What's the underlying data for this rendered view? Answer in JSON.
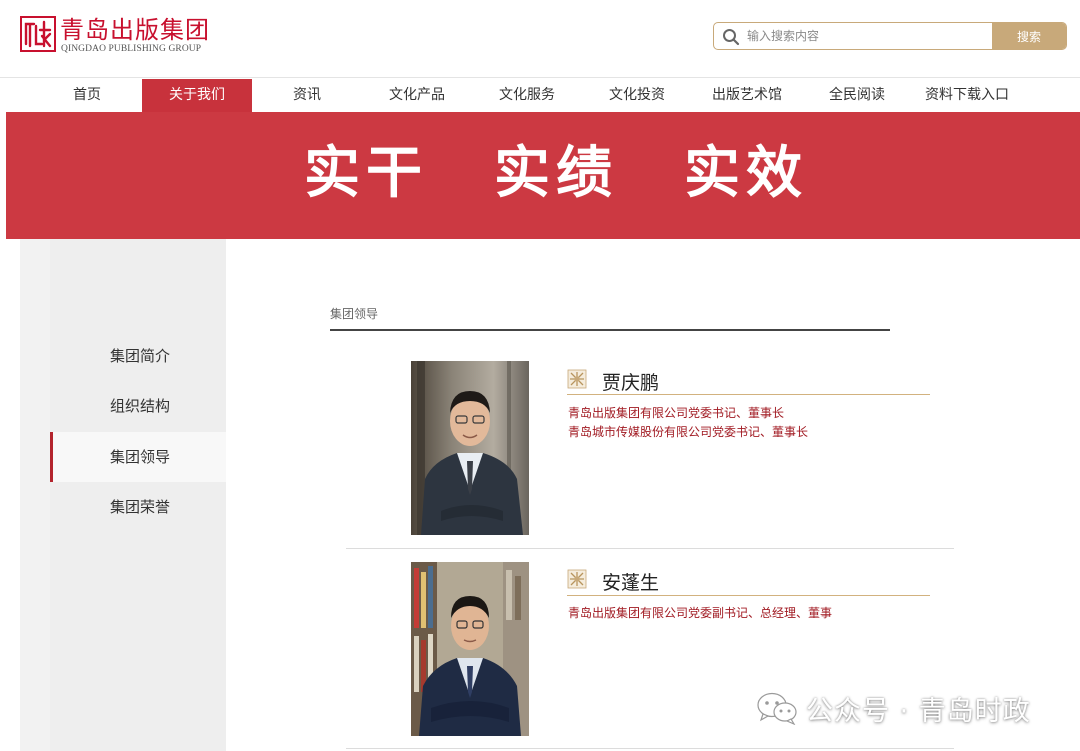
{
  "header": {
    "logo_cn": "青岛出版集团",
    "logo_en": "QINGDAO PUBLISHING GROUP",
    "search_placeholder": "输入搜索内容",
    "search_button": "搜索"
  },
  "nav": {
    "items": [
      "首页",
      "关于我们",
      "资讯",
      "文化产品",
      "文化服务",
      "文化投资",
      "出版艺术馆",
      "全民阅读",
      "资料下载入口"
    ],
    "active_index": 1
  },
  "banner": {
    "words": [
      "实干",
      "实绩",
      "实效"
    ],
    "background": "#cc3942"
  },
  "sidebar": {
    "items": [
      "集团简介",
      "组织结构",
      "集团领导",
      "集团荣誉"
    ],
    "active_index": 2
  },
  "main": {
    "section_title": "集团领导",
    "leaders": [
      {
        "name": "贾庆鹏",
        "titles": [
          "青岛出版集团有限公司党委书记、董事长",
          "青岛城市传媒股份有限公司党委书记、董事长"
        ]
      },
      {
        "name": "安蓬生",
        "titles": [
          "青岛出版集团有限公司党委副书记、总经理、董事"
        ]
      }
    ]
  },
  "watermark": {
    "text": "公众号 · 青岛时政"
  },
  "colors": {
    "accent_red": "#c8323c",
    "gold": "#c8a97a",
    "title_red": "#a11a22"
  }
}
